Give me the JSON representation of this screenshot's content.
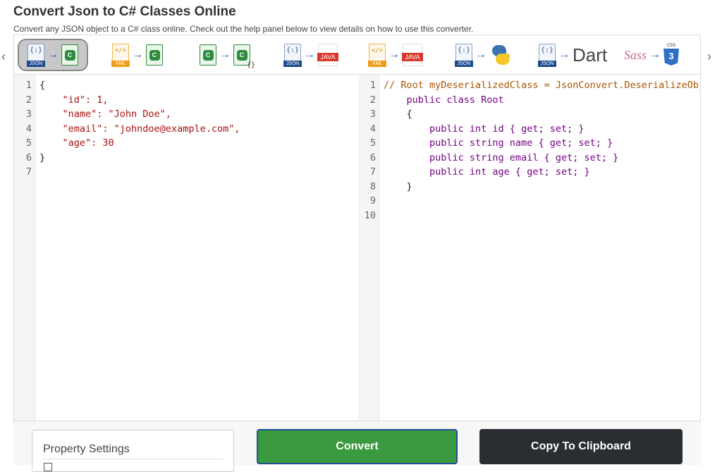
{
  "header": {
    "title": "Convert Json to C# Classes Online",
    "description": "Convert any JSON object to a C# class online. Check out the help panel below to view details on how to use this converter."
  },
  "toolbar": {
    "nav_left_icon": "chevron-left-icon",
    "nav_right_icon": "chevron-right-icon",
    "converters": [
      {
        "from": "JSON",
        "to": "C#",
        "active": true
      },
      {
        "from": "XML",
        "to": "C#",
        "active": false
      },
      {
        "from": "C#",
        "to": "C# {}",
        "active": false
      },
      {
        "from": "JSON",
        "to": "JAVA",
        "active": false
      },
      {
        "from": "XML",
        "to": "JAVA",
        "active": false
      },
      {
        "from": "JSON",
        "to": "Python",
        "active": false
      },
      {
        "from": "JSON",
        "to": "Dart",
        "active": false
      },
      {
        "from": "Sass",
        "to": "CSS",
        "active": false
      }
    ],
    "labels": {
      "json": "JSON",
      "xml": "XML",
      "java": "JAVA",
      "dart": "Dart",
      "sass": "Sass",
      "css": "CSS",
      "cs": "C",
      "braces": "{}",
      "json_glyph": "{:}",
      "xml_glyph": "</>",
      "arrow": "→"
    }
  },
  "input_editor": {
    "line_numbers": [
      "1",
      "2",
      "3",
      "4",
      "5",
      "6",
      "7"
    ],
    "lines": [
      "{",
      "    \"id\": 1,",
      "    \"name\": \"John Doe\",",
      "    \"email\": \"johndoe@example.com\",",
      "    \"age\": 30",
      "}",
      ""
    ]
  },
  "output_editor": {
    "line_numbers": [
      "1",
      "2",
      "3",
      "4",
      "5",
      "6",
      "7",
      "8",
      "9",
      "10"
    ],
    "lines": [
      "// Root myDeserializedClass = JsonConvert.DeserializeObject<Root>(myJsonResponse);",
      "    public class Root",
      "    {",
      "        public int id { get; set; }",
      "        public string name { get; set; }",
      "        public string email { get; set; }",
      "        public int age { get; set; }",
      "    }",
      "",
      ""
    ]
  },
  "footer": {
    "property_settings_label": "Property Settings",
    "convert_label": "Convert",
    "copy_label": "Copy To Clipboard"
  },
  "colors": {
    "convert_bg": "#3a9a3f",
    "copy_bg": "#2a2d31",
    "active_converter_bg": "#c8c8c8"
  }
}
